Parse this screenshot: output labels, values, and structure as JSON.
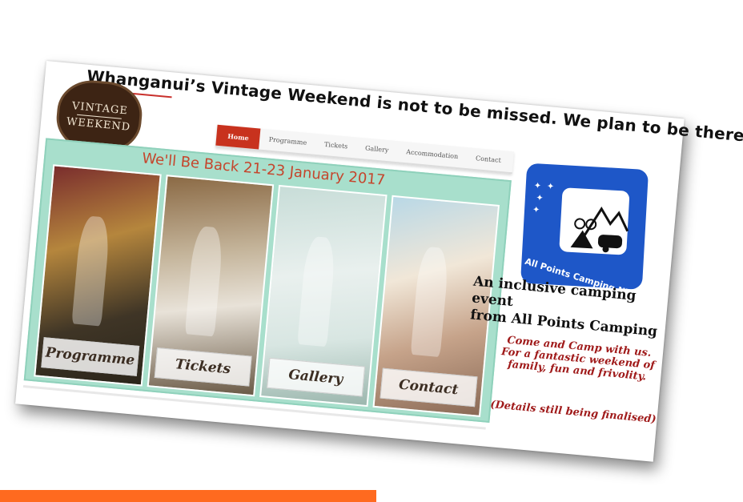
{
  "headline": "Whanganui’s Vintage Weekend is not to be missed. We plan to be there.",
  "logo": {
    "line1": "VINTAGE",
    "line2": "WEEKEND"
  },
  "nav": {
    "items": [
      "Home",
      "Programme",
      "Tickets",
      "Gallery",
      "Accommodation",
      "Contact"
    ],
    "active": "Home"
  },
  "banner": {
    "title": "We'll Be Back 21-23 January 2017",
    "tiles": [
      "Programme",
      "Tickets",
      "Gallery",
      "Contact"
    ]
  },
  "badge": {
    "text": "All Points Camping NZ"
  },
  "tagline": {
    "line1": "An inclusive camping event",
    "line2": "from  All Points Camping"
  },
  "invite": {
    "line1": "Come and Camp with us.",
    "line2": "For a fantastic weekend of",
    "line3": "family, fun and frivolity."
  },
  "note": "(Details still being finalised)",
  "colors": {
    "accent_orange": "#ff6a1f",
    "nav_active": "#c8321e",
    "banner_bg": "#a8dfcc",
    "badge_blue": "#1e57c8",
    "invite_red": "#a01b1b"
  }
}
